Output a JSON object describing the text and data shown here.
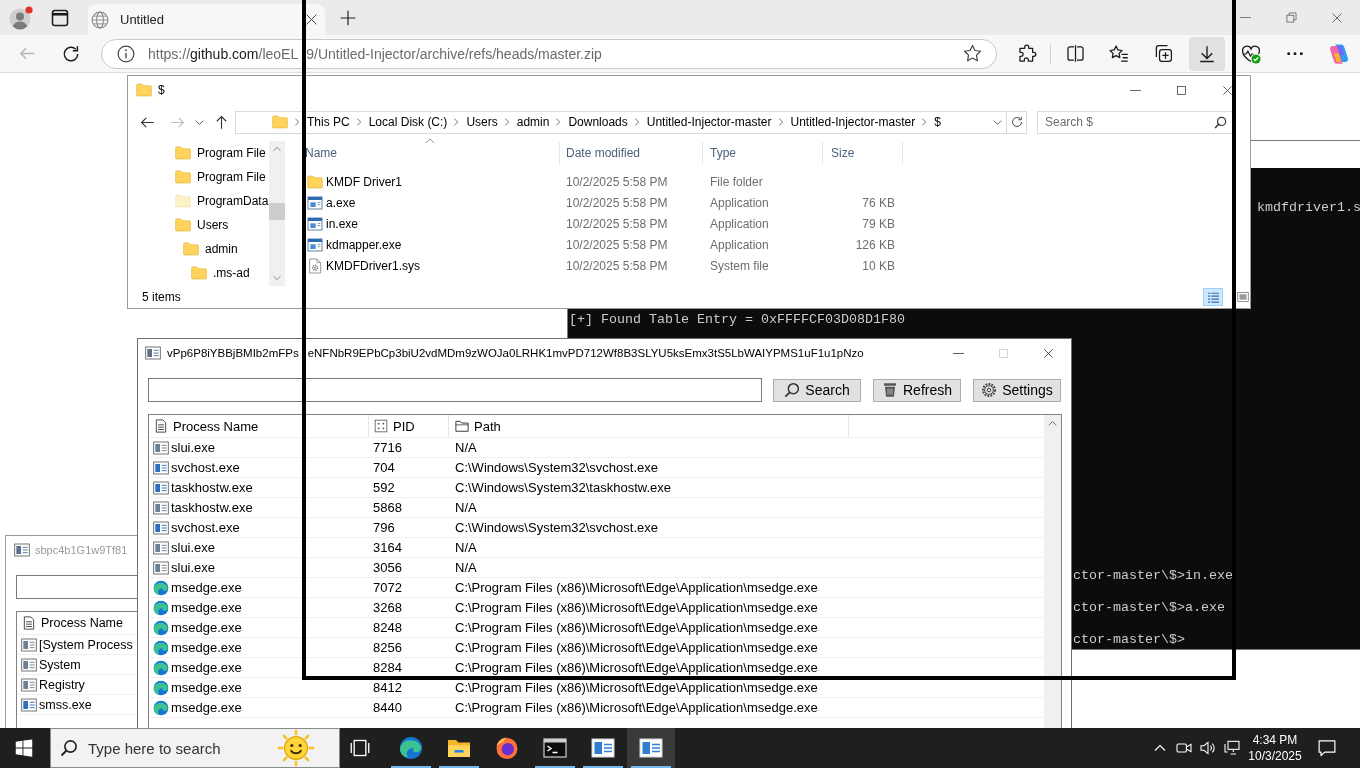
{
  "browser": {
    "tabs": [
      {
        "title": "Untitled",
        "selected": true
      }
    ],
    "address_bar": {
      "scheme": "https://",
      "host": "github.com",
      "path": "/leoEL",
      "path_continued": "9/Untitled-Injector/archive/refs/heads/master.zip"
    },
    "downloads_button": {
      "selected": true
    }
  },
  "terminal": {
    "lines": [
      "kmdfdriver1.s",
      "[+] Found Table Entry = 0xFFFFCF03D08D1F80",
      "ctor-master\\$>in.exe",
      "ctor-master\\$>a.exe",
      "ctor-master\\$>"
    ]
  },
  "explorer": {
    "title": "$",
    "breadcrumb": [
      "This PC",
      "Local Disk (C:)",
      "Users",
      "admin",
      "Downloads",
      "Untitled-Injector-master",
      "Untitled-Injector-master",
      "$"
    ],
    "search": {
      "placeholder": "Search $"
    },
    "nav_items": [
      {
        "label": "Program File",
        "hidden": false
      },
      {
        "label": "Program File",
        "hidden": false
      },
      {
        "label": "ProgramData",
        "hidden": true
      },
      {
        "label": "Users",
        "hidden": false,
        "children": [
          {
            "label": "admin",
            "hidden": false,
            "children": [
              {
                "label": ".ms-ad",
                "hidden": false
              }
            ]
          }
        ]
      }
    ],
    "columns": [
      "Name",
      "Date modified",
      "Type",
      "Size"
    ],
    "files": [
      {
        "kind": "folder",
        "name": "KMDF Driver1",
        "date": "10/2/2025 5:58 PM",
        "type": "File folder"
      },
      {
        "kind": "application",
        "name": "a.exe",
        "date": "10/2/2025 5:58 PM",
        "type": "Application",
        "size": "76 KB"
      },
      {
        "kind": "application",
        "name": "in.exe",
        "date": "10/2/2025 5:58 PM",
        "type": "Application",
        "size": "79 KB"
      },
      {
        "kind": "application",
        "name": "kdmapper.exe",
        "date": "10/2/2025 5:58 PM",
        "type": "Application",
        "size": "126 KB"
      },
      {
        "kind": "system",
        "name": "KMDFDriver1.sys",
        "date": "10/2/2025 5:58 PM",
        "type": "System file",
        "size": "10 KB"
      }
    ],
    "status": "5 items",
    "views": [
      {
        "kind": "details",
        "selected": true
      },
      {
        "kind": "large-icons",
        "selected": false
      }
    ]
  },
  "second_window": {
    "title": "sbpc4b1G1w9Tf81",
    "active": false,
    "columns": [
      "Process Name"
    ],
    "rows": [
      {
        "kind": "default",
        "name": "[System Process"
      },
      {
        "kind": "default",
        "name": "System"
      },
      {
        "kind": "default",
        "name": "Registry"
      },
      {
        "kind": "service",
        "name": "smss.exe"
      }
    ]
  },
  "process_window": {
    "title_parts": [
      "vPp6P8iYBBjBMIb2mFPs",
      "eNFNbR9EPbCp3biU2vdMDm9zWOJa0LRHK1mvPD712Wf8B3SLYU5ksEmx3tS5LbWAIYPMS1uF1u1pNzo"
    ],
    "active": true,
    "maximize": {
      "disabled": true
    },
    "buttons": [
      {
        "kind": "search",
        "label": "Search"
      },
      {
        "kind": "refresh",
        "label": "Refresh"
      },
      {
        "kind": "settings",
        "label": "Settings"
      }
    ],
    "columns": [
      {
        "kind": "name",
        "label": "Process Name"
      },
      {
        "kind": "pid",
        "label": "PID"
      },
      {
        "kind": "path",
        "label": "Path"
      }
    ],
    "rows": [
      {
        "kind": "default",
        "name": "slui.exe",
        "pid": "7716",
        "path": "N/A"
      },
      {
        "kind": "service",
        "name": "svchost.exe",
        "pid": "704",
        "path": "C:\\Windows\\System32\\svchost.exe"
      },
      {
        "kind": "service",
        "name": "taskhostw.exe",
        "pid": "592",
        "path": "C:\\Windows\\System32\\taskhostw.exe"
      },
      {
        "kind": "default",
        "name": "taskhostw.exe",
        "pid": "5868",
        "path": "N/A"
      },
      {
        "kind": "service",
        "name": "svchost.exe",
        "pid": "796",
        "path": "C:\\Windows\\System32\\svchost.exe"
      },
      {
        "kind": "default",
        "name": "slui.exe",
        "pid": "3164",
        "path": "N/A"
      },
      {
        "kind": "default",
        "name": "slui.exe",
        "pid": "3056",
        "path": "N/A"
      },
      {
        "kind": "edge",
        "name": "msedge.exe",
        "pid": "7072",
        "path": "C:\\Program Files (x86)\\Microsoft\\Edge\\Application\\msedge.exe"
      },
      {
        "kind": "edge",
        "name": "msedge.exe",
        "pid": "3268",
        "path": "C:\\Program Files (x86)\\Microsoft\\Edge\\Application\\msedge.exe"
      },
      {
        "kind": "edge",
        "name": "msedge.exe",
        "pid": "8248",
        "path": "C:\\Program Files (x86)\\Microsoft\\Edge\\Application\\msedge.exe"
      },
      {
        "kind": "edge",
        "name": "msedge.exe",
        "pid": "8256",
        "path": "C:\\Program Files (x86)\\Microsoft\\Edge\\Application\\msedge.exe"
      },
      {
        "kind": "edge",
        "name": "msedge.exe",
        "pid": "8284",
        "path": "C:\\Program Files (x86)\\Microsoft\\Edge\\Application\\msedge.exe"
      },
      {
        "kind": "edge",
        "name": "msedge.exe",
        "pid": "8412",
        "path": "C:\\Program Files (x86)\\Microsoft\\Edge\\Application\\msedge.exe"
      },
      {
        "kind": "edge",
        "name": "msedge.exe",
        "pid": "8440",
        "path": "C:\\Program Files (x86)\\Microsoft\\Edge\\Application\\msedge.exe"
      }
    ]
  },
  "taskbar": {
    "search": {
      "placeholder": "Type here to search"
    },
    "apps": [
      {
        "kind": "edge",
        "running": true,
        "selected": false
      },
      {
        "kind": "explorer",
        "running": true,
        "selected": false
      },
      {
        "kind": "firefox",
        "running": false,
        "selected": false
      },
      {
        "kind": "terminal",
        "running": true,
        "selected": false
      },
      {
        "kind": "window",
        "running": true,
        "selected": false
      },
      {
        "kind": "window",
        "running": true,
        "selected": true
      }
    ],
    "time": "4:34 PM",
    "date": "10/3/2025"
  }
}
